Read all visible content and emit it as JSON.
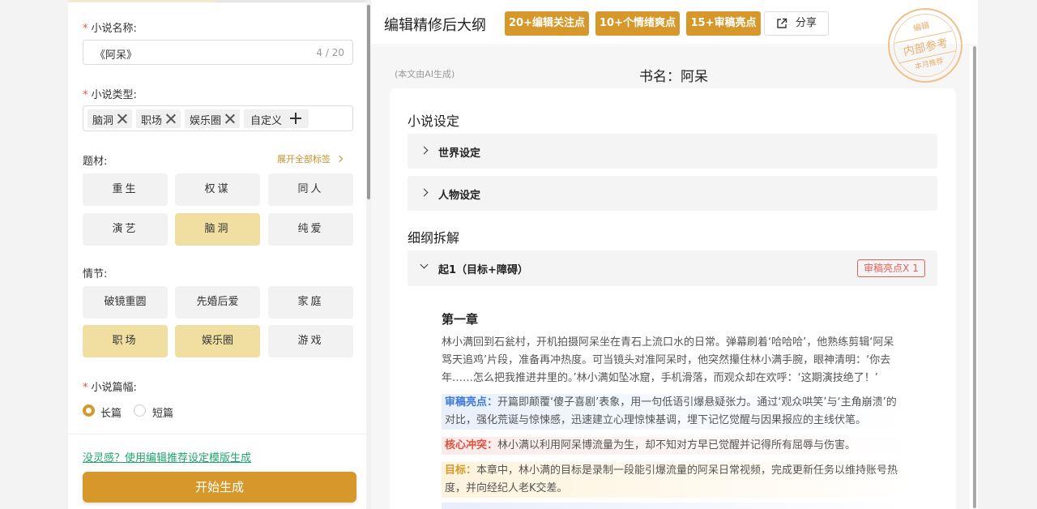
{
  "form": {
    "novel_name_label": "小说名称:",
    "novel_name_value": "《阿呆》",
    "novel_name_count": "4 / 20",
    "novel_type_label": "小说类型:",
    "type_tags": [
      "脑洞",
      "职场",
      "娱乐圈"
    ],
    "custom_tag_label": "自定义",
    "theme_label": "题材:",
    "expand_label": "展开全部标签",
    "theme_chips": [
      {
        "label": "重生",
        "selected": false
      },
      {
        "label": "权谋",
        "selected": false
      },
      {
        "label": "同人",
        "selected": false
      },
      {
        "label": "演艺",
        "selected": false
      },
      {
        "label": "脑洞",
        "selected": true
      },
      {
        "label": "纯爱",
        "selected": false
      }
    ],
    "plot_label": "情节:",
    "plot_chips": [
      {
        "label": "破镜重圆",
        "selected": false
      },
      {
        "label": "先婚后爱",
        "selected": false
      },
      {
        "label": "家庭",
        "selected": false
      },
      {
        "label": "职场",
        "selected": true
      },
      {
        "label": "娱乐圈",
        "selected": true
      },
      {
        "label": "游戏",
        "selected": false
      }
    ],
    "length_label": "小说篇幅:",
    "length_options": [
      {
        "label": "长篇",
        "selected": true
      },
      {
        "label": "短篇",
        "selected": false
      }
    ],
    "inspire_link": "没灵感？使用编辑推荐设定模版生成",
    "generate_button": "开始生成"
  },
  "outline": {
    "title": "编辑精修后大纲",
    "badges": [
      "20+编辑关注点",
      "10+个情绪爽点",
      "15+审稿亮点"
    ],
    "share_label": "分享",
    "stamp": {
      "top": "编辑",
      "middle": "内部参考",
      "bottom": "本月推荐"
    },
    "ai_note": "(本文由AI生成)",
    "book_name": "书名：阿呆",
    "section_setting": "小说设定",
    "accordion_world": "世界设定",
    "accordion_character": "人物设定",
    "section_breakdown": "细纲拆解",
    "accordion_part1": "起1（目标+障碍）",
    "highlight_badge": "审稿亮点X 1",
    "chapter_title": "第一章",
    "chapter_text": "林小满回到石瓮村，开机拍摄阿呆坐在青石上流口水的日常。弹幕刷着‘哈哈哈’，他熟练剪辑‘阿呆骂天追鸡’片段，准备再冲热度。可当镜头对准阿呆时，他突然攥住林小满手腕，眼神清明：‘你去年……怎么把我推进井里的。’林小满如坠冰窟，手机滑落，而观众却在欢呼：‘这期演技绝了！’",
    "notes": {
      "review_label": "审稿亮点：",
      "review_text": "开篇即颠覆‘傻子喜剧’表象，用一句低语引爆悬疑张力。通过‘观众哄笑’与‘主角崩溃’的对比，强化荒诞与惊悚感，迅速建立心理惊悚基调，埋下记忆觉醒与因果报应的主线伏笔。",
      "conflict_label": "核心冲突：",
      "conflict_text": "林小满以利用阿呆博流量为生，却不知对方早已觉醒并记得所有屈辱与伤害。",
      "goal_label": "目标：",
      "goal_text": "本章中，林小满的目标是录制一段能引爆流量的阿呆日常视频，完成更新任务以维持账号热度，并向经纪人老K交差。"
    }
  },
  "colors": {
    "accent": "#d6982a",
    "selected_chip": "#f0dfa0",
    "link_green": "#1fa56a",
    "review_blue": "#3e79d6",
    "conflict_red": "#e0523c"
  }
}
